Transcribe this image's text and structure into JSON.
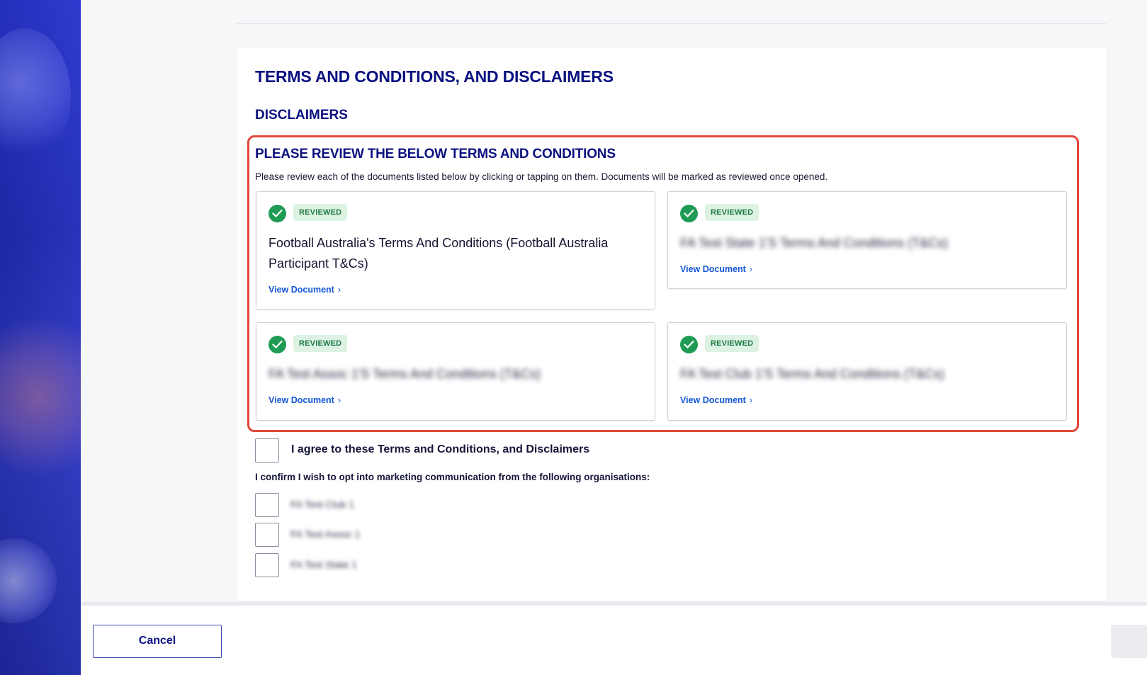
{
  "page": {
    "title": "TERMS AND CONDITIONS, AND DISCLAIMERS",
    "subtitle": "DISCLAIMERS"
  },
  "review": {
    "heading": "PLEASE REVIEW THE BELOW TERMS AND CONDITIONS",
    "description": "Please review each of the documents listed below by clicking or tapping on them. Documents will be marked as reviewed once opened.",
    "documents": [
      {
        "status": "REVIEWED",
        "title": "Football Australia's Terms And Conditions (Football Australia Participant T&Cs)",
        "link": "View Document"
      },
      {
        "status": "REVIEWED",
        "title": "FA Test State 1'S Terms And Conditions (T&Cs)",
        "link": "View Document"
      },
      {
        "status": "REVIEWED",
        "title": "FA Test Assoc 1'S Terms And Conditions (T&Cs)",
        "link": "View Document"
      },
      {
        "status": "REVIEWED",
        "title": "FA Test Club 1'S Terms And Conditions (T&Cs)",
        "link": "View Document"
      }
    ]
  },
  "agreement": {
    "label": "I agree to these Terms and Conditions, and Disclaimers",
    "checked": false
  },
  "marketing": {
    "label": "I confirm I wish to opt into marketing communication from the following organisations:",
    "options": [
      {
        "label": "FA Test Club 1",
        "checked": false
      },
      {
        "label": "FA Test Assoc 1",
        "checked": false
      },
      {
        "label": "FA Test State 1",
        "checked": false
      }
    ]
  },
  "footer": {
    "cancel_label": "Cancel"
  },
  "colors": {
    "brand_navy": "#0a1180",
    "highlight_red": "#e0483c",
    "reviewed_green": "#1f9b54",
    "link_blue": "#1456d6"
  },
  "icons": {
    "reviewed": "check-circle-icon",
    "link": "chevron-right-icon"
  }
}
